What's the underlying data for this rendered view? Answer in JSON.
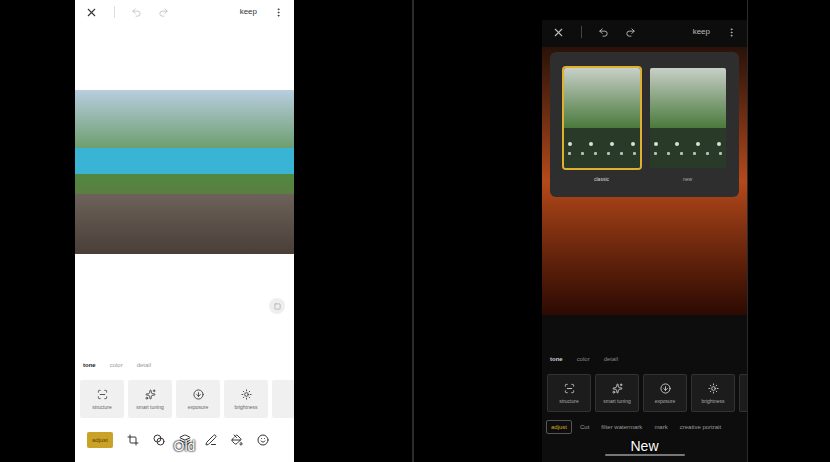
{
  "panels": [
    {
      "label": "Old",
      "kind": "light",
      "keep": "keep",
      "history_enabled": false,
      "tabs": [
        {
          "label": "tone",
          "selected": true
        },
        {
          "label": "color",
          "selected": false
        },
        {
          "label": "detail",
          "selected": false
        }
      ],
      "tools": [
        {
          "label": "structure"
        },
        {
          "label": "smart tuning"
        },
        {
          "label": "exposure"
        },
        {
          "label": "brightness"
        }
      ],
      "bottom": [
        {
          "label": "adjust",
          "selected": true
        }
      ]
    },
    {
      "label": "New",
      "kind": "dark",
      "keep": "keep",
      "history_enabled": true,
      "popup": {
        "options": [
          {
            "label": "classic",
            "selected": true
          },
          {
            "label": "new",
            "selected": false
          }
        ]
      },
      "tabs": [
        {
          "label": "tone",
          "selected": true
        },
        {
          "label": "color",
          "selected": false
        },
        {
          "label": "detail",
          "selected": false
        }
      ],
      "tools": [
        {
          "label": "structure"
        },
        {
          "label": "smart tuning"
        },
        {
          "label": "exposure"
        },
        {
          "label": "brightness"
        }
      ],
      "bottom": [
        {
          "label": "adjust",
          "selected": true
        },
        {
          "label": "Cut",
          "selected": false
        },
        {
          "label": "filter watermark",
          "selected": false
        },
        {
          "label": "mark",
          "selected": false
        },
        {
          "label": "creative portrait",
          "selected": false
        }
      ]
    }
  ]
}
